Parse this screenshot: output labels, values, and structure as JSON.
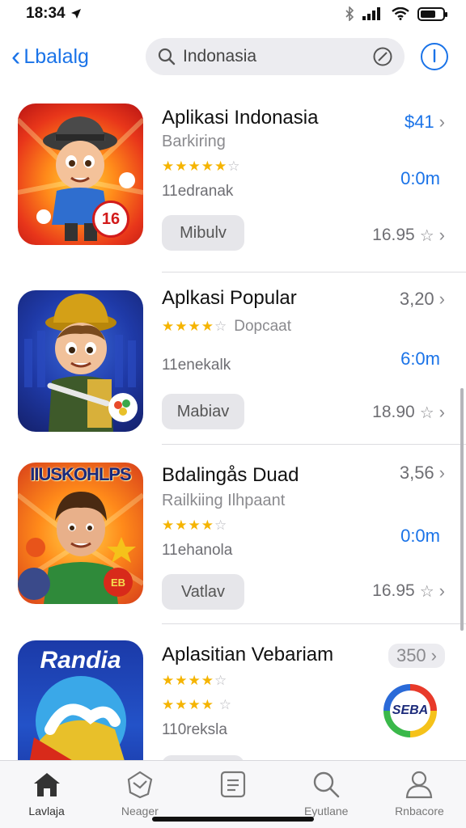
{
  "status": {
    "time": "18:34"
  },
  "nav": {
    "back_label": "Lbalalg",
    "search_value": "Indonasia"
  },
  "apps": [
    {
      "name": "Aplikasi Indonasia",
      "subtitle": "Barkiring",
      "stars": 5,
      "extra_sub": "",
      "count": "11edranak",
      "get_label": "Mibulv",
      "price": "$41",
      "price_color": "#1a73e8",
      "time": "0:0m",
      "rating": "16.95",
      "icon_badge": "16"
    },
    {
      "name": "Aplkasi Popular",
      "subtitle": "",
      "stars": 4,
      "extra_sub": "Dopcaat",
      "count": "11enekalk",
      "get_label": "Mabiav",
      "price": "3,20",
      "price_color": "#6e6e73",
      "time": "6:0m",
      "rating": "18.90",
      "icon_badge": ""
    },
    {
      "name": "Bdalingås Duad",
      "subtitle": "Railkiing  Ilhpaant",
      "stars": 4,
      "extra_sub": "",
      "count": "11ehanola",
      "get_label": "Vatlav",
      "price": "3,56",
      "price_color": "#6e6e73",
      "time": "0:0m",
      "rating": "16.95",
      "icon_badge": "",
      "icon_title": "IIUSKOHLPS"
    },
    {
      "name": "Aplasitian Vebariam",
      "subtitle": "",
      "stars": 4,
      "extra_sub": "",
      "count": "110reksla",
      "get_label": "",
      "price": "350",
      "price_color": "#8a8a8e",
      "time": "",
      "rating": "",
      "icon_badge": "SEBA",
      "icon_title": "Randia"
    }
  ],
  "tabs": [
    {
      "label": "Lavlaja",
      "icon": "home-icon"
    },
    {
      "label": "Neager",
      "icon": "map-icon"
    },
    {
      "label": "Eyutlane",
      "icon": "search-icon"
    },
    {
      "label": "Rnbacore",
      "icon": "person-icon"
    }
  ],
  "tab_middle": {
    "icon": "list-icon"
  },
  "colors": {
    "accent": "#1a73e8",
    "star": "#f5b400"
  }
}
